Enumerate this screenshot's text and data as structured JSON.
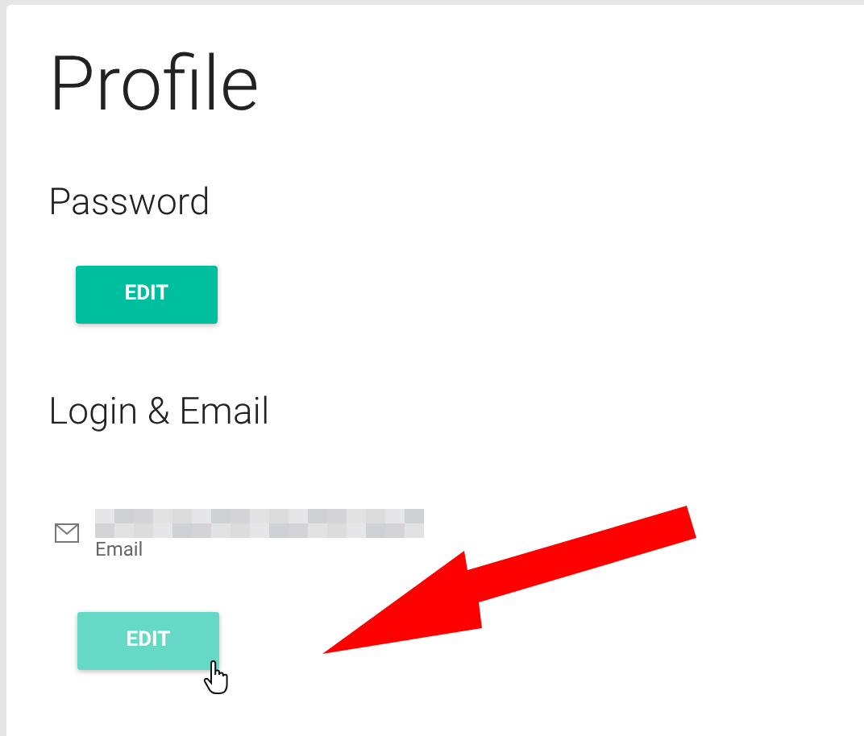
{
  "title": "Profile",
  "sections": [
    {
      "heading": "Password",
      "button": {
        "label": "EDIT",
        "hovered": false
      }
    },
    {
      "heading": "Login & Email",
      "field": {
        "caption": "Email"
      },
      "button": {
        "label": "EDIT",
        "hovered": true
      }
    }
  ],
  "annotation": {
    "kind": "arrow"
  }
}
